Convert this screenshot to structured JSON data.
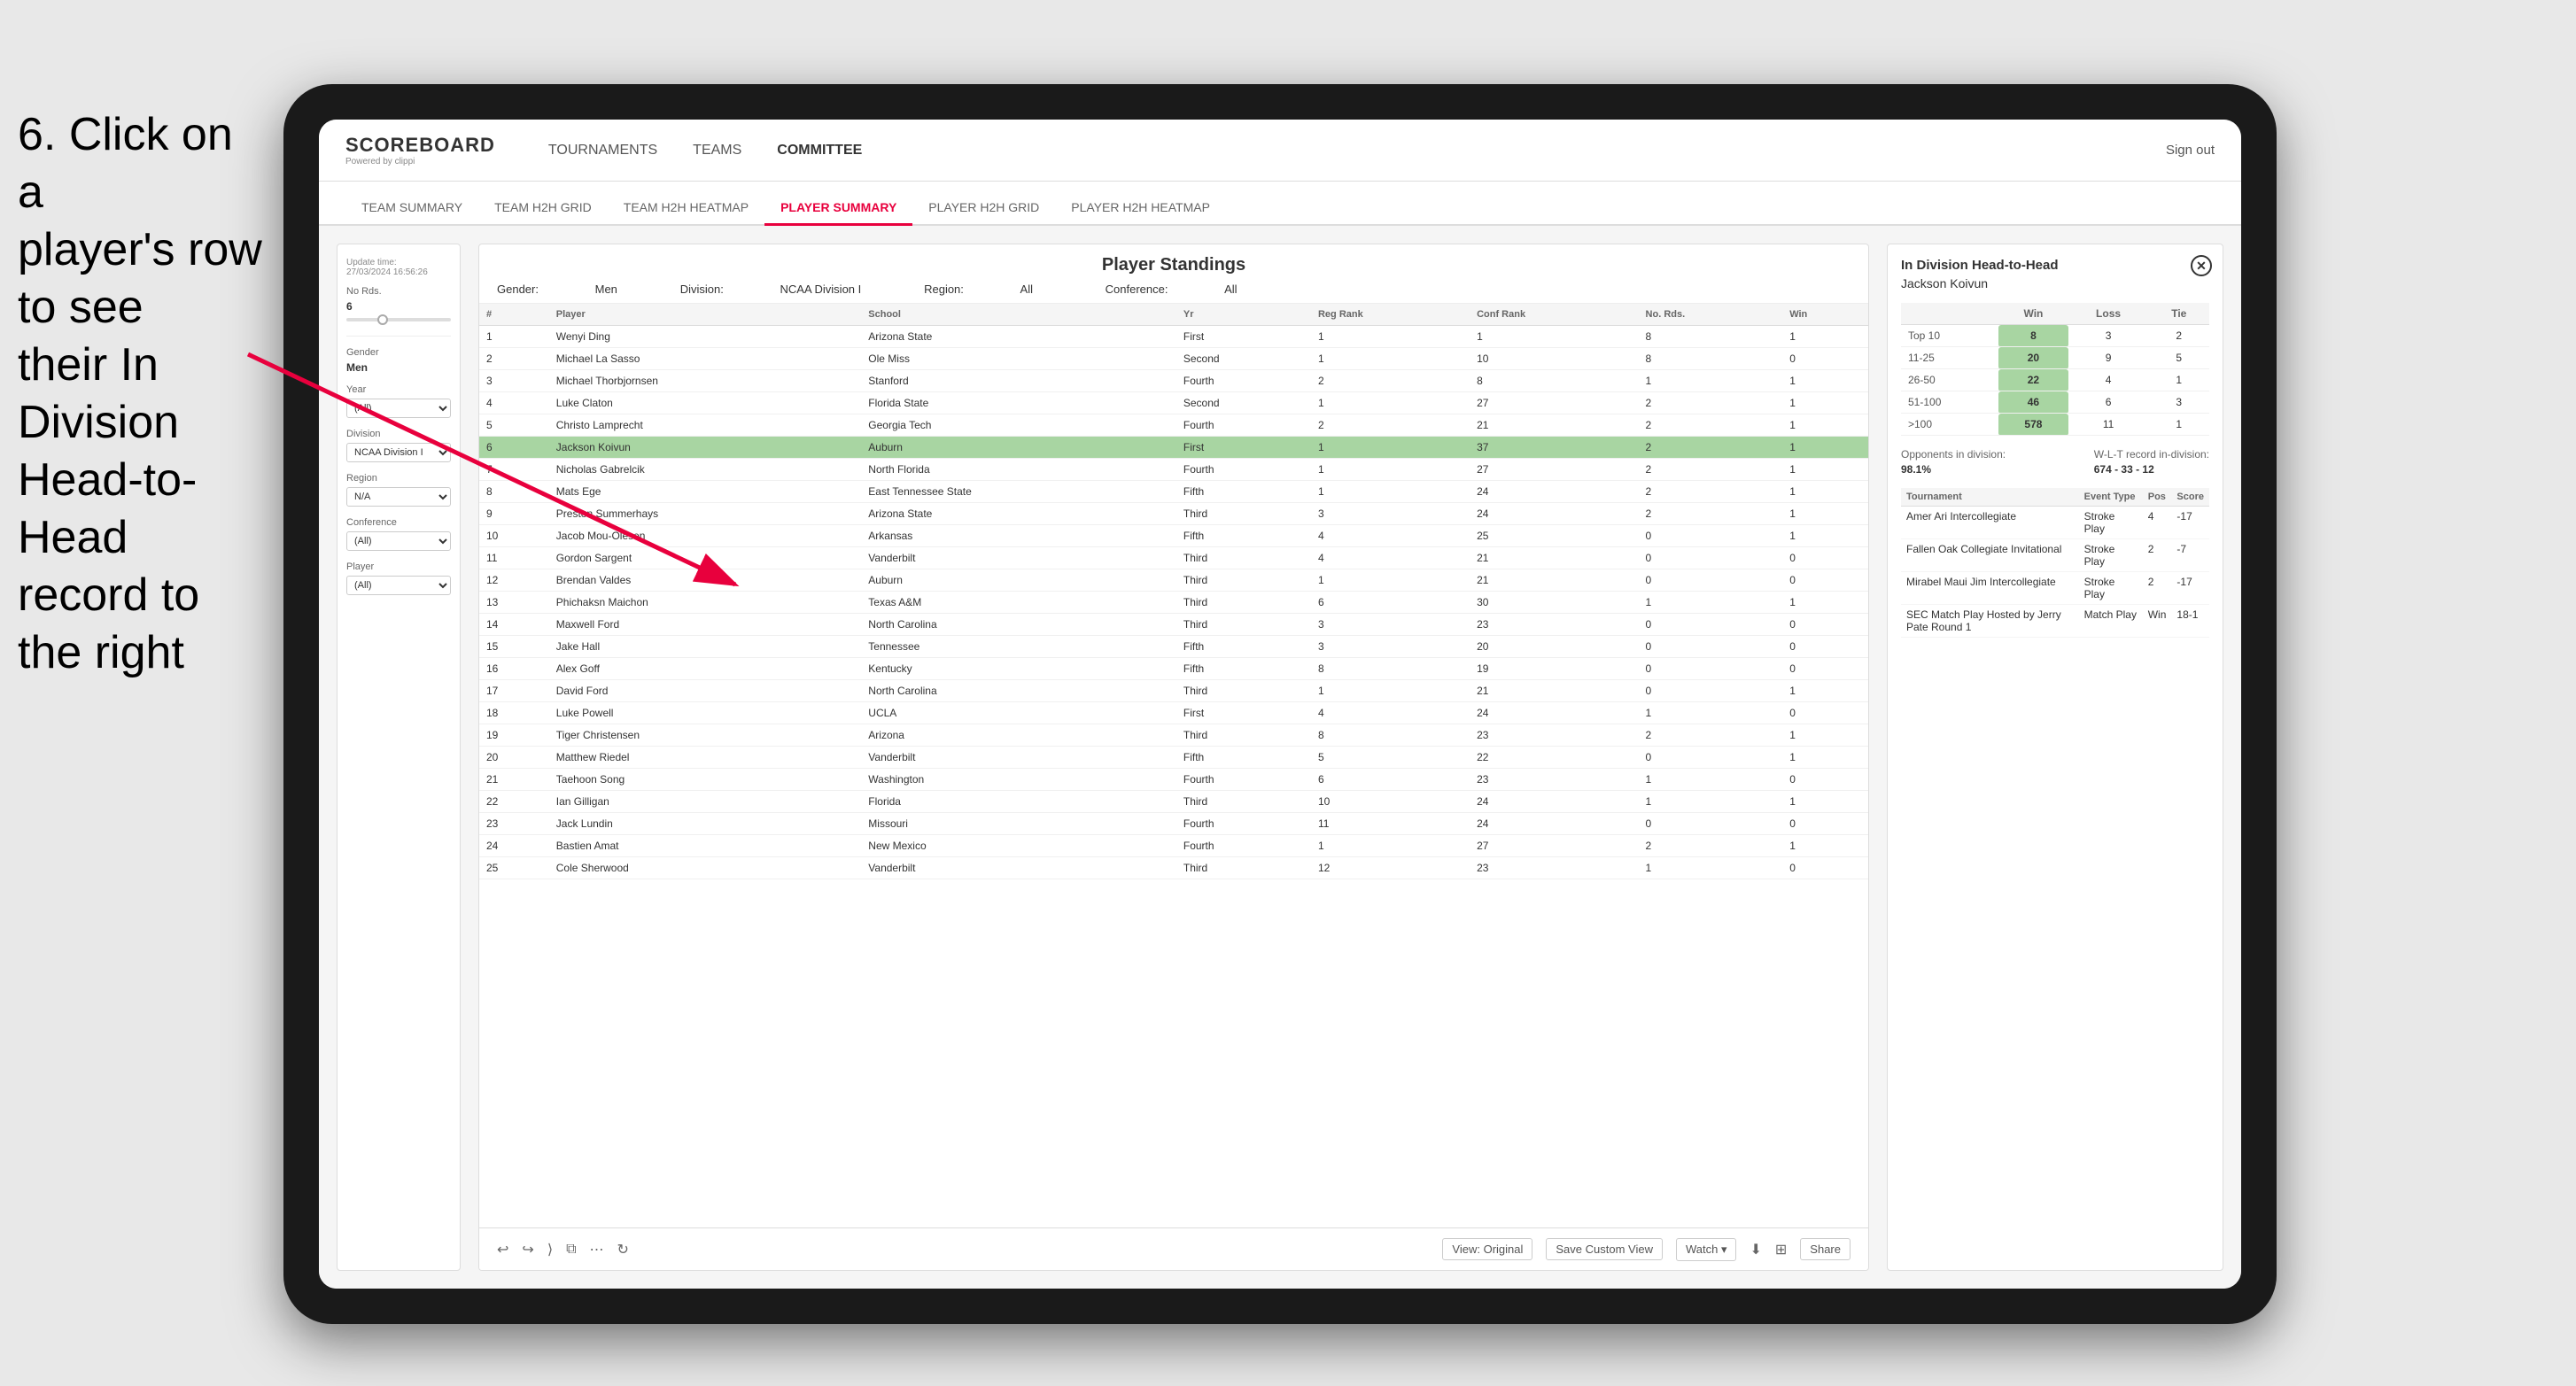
{
  "instruction": {
    "line1": "6. Click on a",
    "line2": "player's row to see",
    "line3": "their In Division",
    "line4": "Head-to-Head",
    "line5": "record to the right"
  },
  "app": {
    "logo": "SCOREBOARD",
    "logo_sub": "Powered by clippi",
    "sign_out": "Sign out"
  },
  "nav": {
    "items": [
      "TOURNAMENTS",
      "TEAMS",
      "COMMITTEE"
    ]
  },
  "sub_nav": {
    "items": [
      "TEAM SUMMARY",
      "TEAM H2H GRID",
      "TEAM H2H HEATMAP",
      "PLAYER SUMMARY",
      "PLAYER H2H GRID",
      "PLAYER H2H HEATMAP"
    ],
    "active": "PLAYER SUMMARY"
  },
  "filters": {
    "update_label": "Update time:",
    "update_value": "27/03/2024 16:56:26",
    "no_rds_label": "No Rds.",
    "no_rds_value": "6",
    "gender_label": "Gender",
    "gender_value": "Men",
    "year_label": "Year",
    "year_value": "(All)",
    "division_label": "Division",
    "division_value": "NCAA Division I",
    "region_label": "Region",
    "region_value": "N/A",
    "conference_label": "Conference",
    "conference_value": "(All)",
    "player_label": "Player",
    "player_value": "(All)"
  },
  "standings": {
    "title": "Player Standings",
    "gender_label": "Gender:",
    "gender_value": "Men",
    "division_label": "Division:",
    "division_value": "NCAA Division I",
    "region_label": "Region:",
    "region_value": "All",
    "conference_label": "Conference:",
    "conference_value": "All",
    "columns": [
      "#",
      "Player",
      "School",
      "Yr",
      "Reg Rank",
      "Conf Rank",
      "No. Rds.",
      "Win"
    ],
    "rows": [
      {
        "num": 1,
        "player": "Wenyi Ding",
        "school": "Arizona State",
        "yr": "First",
        "reg": 1,
        "conf": 1,
        "rds": 8,
        "win": 1
      },
      {
        "num": 2,
        "player": "Michael La Sasso",
        "school": "Ole Miss",
        "yr": "Second",
        "reg": 1,
        "conf": 10,
        "rds": 8,
        "win": 0
      },
      {
        "num": 3,
        "player": "Michael Thorbjornsen",
        "school": "Stanford",
        "yr": "Fourth",
        "reg": 2,
        "conf": 8,
        "rds": 1,
        "win": 1
      },
      {
        "num": 4,
        "player": "Luke Claton",
        "school": "Florida State",
        "yr": "Second",
        "reg": 1,
        "conf": 27,
        "rds": 2,
        "win": 1
      },
      {
        "num": 5,
        "player": "Christo Lamprecht",
        "school": "Georgia Tech",
        "yr": "Fourth",
        "reg": 2,
        "conf": 21,
        "rds": 2,
        "win": 1
      },
      {
        "num": 6,
        "player": "Jackson Koivun",
        "school": "Auburn",
        "yr": "First",
        "reg": 1,
        "conf": 37,
        "rds": 2,
        "win": 1
      },
      {
        "num": 7,
        "player": "Nicholas Gabrelcik",
        "school": "North Florida",
        "yr": "Fourth",
        "reg": 1,
        "conf": 27,
        "rds": 2,
        "win": 1
      },
      {
        "num": 8,
        "player": "Mats Ege",
        "school": "East Tennessee State",
        "yr": "Fifth",
        "reg": 1,
        "conf": 24,
        "rds": 2,
        "win": 1
      },
      {
        "num": 9,
        "player": "Preston Summerhays",
        "school": "Arizona State",
        "yr": "Third",
        "reg": 3,
        "conf": 24,
        "rds": 2,
        "win": 1
      },
      {
        "num": 10,
        "player": "Jacob Mou-Olesen",
        "school": "Arkansas",
        "yr": "Fifth",
        "reg": 4,
        "conf": 25,
        "rds": 0,
        "win": 1
      },
      {
        "num": 11,
        "player": "Gordon Sargent",
        "school": "Vanderbilt",
        "yr": "Third",
        "reg": 4,
        "conf": 21,
        "rds": 0,
        "win": 0
      },
      {
        "num": 12,
        "player": "Brendan Valdes",
        "school": "Auburn",
        "yr": "Third",
        "reg": 1,
        "conf": 21,
        "rds": 0,
        "win": 0
      },
      {
        "num": 13,
        "player": "Phichaksn Maichon",
        "school": "Texas A&M",
        "yr": "Third",
        "reg": 6,
        "conf": 30,
        "rds": 1,
        "win": 1
      },
      {
        "num": 14,
        "player": "Maxwell Ford",
        "school": "North Carolina",
        "yr": "Third",
        "reg": 3,
        "conf": 23,
        "rds": 0,
        "win": 0
      },
      {
        "num": 15,
        "player": "Jake Hall",
        "school": "Tennessee",
        "yr": "Fifth",
        "reg": 3,
        "conf": 20,
        "rds": 0,
        "win": 0
      },
      {
        "num": 16,
        "player": "Alex Goff",
        "school": "Kentucky",
        "yr": "Fifth",
        "reg": 8,
        "conf": 19,
        "rds": 0,
        "win": 0
      },
      {
        "num": 17,
        "player": "David Ford",
        "school": "North Carolina",
        "yr": "Third",
        "reg": 1,
        "conf": 21,
        "rds": 0,
        "win": 1
      },
      {
        "num": 18,
        "player": "Luke Powell",
        "school": "UCLA",
        "yr": "First",
        "reg": 4,
        "conf": 24,
        "rds": 1,
        "win": 0
      },
      {
        "num": 19,
        "player": "Tiger Christensen",
        "school": "Arizona",
        "yr": "Third",
        "reg": 8,
        "conf": 23,
        "rds": 2,
        "win": 1
      },
      {
        "num": 20,
        "player": "Matthew Riedel",
        "school": "Vanderbilt",
        "yr": "Fifth",
        "reg": 5,
        "conf": 22,
        "rds": 0,
        "win": 1
      },
      {
        "num": 21,
        "player": "Taehoon Song",
        "school": "Washington",
        "yr": "Fourth",
        "reg": 6,
        "conf": 23,
        "rds": 1,
        "win": 0
      },
      {
        "num": 22,
        "player": "Ian Gilligan",
        "school": "Florida",
        "yr": "Third",
        "reg": 10,
        "conf": 24,
        "rds": 1,
        "win": 1
      },
      {
        "num": 23,
        "player": "Jack Lundin",
        "school": "Missouri",
        "yr": "Fourth",
        "reg": 11,
        "conf": 24,
        "rds": 0,
        "win": 0
      },
      {
        "num": 24,
        "player": "Bastien Amat",
        "school": "New Mexico",
        "yr": "Fourth",
        "reg": 1,
        "conf": 27,
        "rds": 2,
        "win": 1
      },
      {
        "num": 25,
        "player": "Cole Sherwood",
        "school": "Vanderbilt",
        "yr": "Third",
        "reg": 12,
        "conf": 23,
        "rds": 1,
        "win": 0
      }
    ]
  },
  "h2h": {
    "title": "In Division Head-to-Head",
    "player": "Jackson Koivun",
    "table": {
      "headers": [
        "",
        "Win",
        "Loss",
        "Tie"
      ],
      "rows": [
        {
          "label": "Top 10",
          "win": 8,
          "loss": 3,
          "tie": 2
        },
        {
          "label": "11-25",
          "win": 20,
          "loss": 9,
          "tie": 5
        },
        {
          "label": "26-50",
          "win": 22,
          "loss": 4,
          "tie": 1
        },
        {
          "label": "51-100",
          "win": 46,
          "loss": 6,
          "tie": 3
        },
        {
          "label": ">100",
          "win": 578,
          "loss": 11,
          "tie": 1
        }
      ]
    },
    "opponents_label": "Opponents in division:",
    "opponents_value": "98.1%",
    "record_label": "W-L-T record in-division:",
    "record_value": "674 - 33 - 12",
    "tournaments": {
      "headers": [
        "Tournament",
        "Event Type",
        "Pos",
        "Score"
      ],
      "rows": [
        {
          "tournament": "Amer Ari Intercollegiate",
          "type": "Stroke Play",
          "pos": 4,
          "score": "-17"
        },
        {
          "tournament": "Fallen Oak Collegiate Invitational",
          "type": "Stroke Play",
          "pos": 2,
          "score": "-7"
        },
        {
          "tournament": "Mirabel Maui Jim Intercollegiate",
          "type": "Stroke Play",
          "pos": 2,
          "score": "-17"
        },
        {
          "tournament": "SEC Match Play Hosted by Jerry Pate Round 1",
          "type": "Match Play",
          "pos": "Win",
          "score": "18-1"
        }
      ]
    }
  },
  "toolbar": {
    "view_original": "View: Original",
    "save_custom": "Save Custom View",
    "watch": "Watch ▾",
    "share": "Share"
  }
}
